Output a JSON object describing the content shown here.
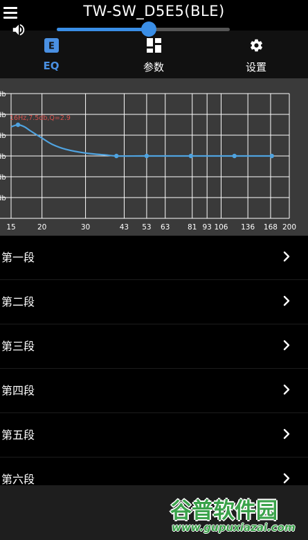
{
  "header": {
    "title": "TW-SW_D5E5(BLE)",
    "menu_icon": "hamburger-menu-icon"
  },
  "tabs": [
    {
      "label": "EQ",
      "icon": "eq-icon",
      "active": true
    },
    {
      "label": "参数",
      "icon": "grid-icon",
      "active": false
    },
    {
      "label": "设置",
      "icon": "gear-icon",
      "active": false
    }
  ],
  "colors": {
    "accent": "#4a90e2",
    "curve": "#4fa3e0",
    "chart_bg": "#3a3a3a",
    "grid": "#ffffff",
    "annotation": "#d9534f"
  },
  "chart_data": {
    "type": "line",
    "x_scale": "log",
    "x_ticks": [
      "15",
      "20",
      "30",
      "43",
      "53",
      "63",
      "81",
      "93",
      "106",
      "136",
      "168",
      "200"
    ],
    "y_tick_labels": [
      "db",
      "db",
      "db",
      "db",
      "db",
      "db"
    ],
    "annotation": "16Hz,7.5db,Q=2.9",
    "series": [
      {
        "x": [
          15,
          16,
          17,
          18,
          20,
          22,
          25,
          30,
          36,
          40,
          50,
          60,
          80,
          100,
          130,
          170
        ],
        "y": [
          7,
          7.5,
          7.0,
          6.0,
          4.3,
          2.8,
          1.6,
          0.7,
          0.25,
          0,
          0,
          0,
          0,
          0,
          0,
          0
        ]
      }
    ],
    "control_points": [
      16,
      40,
      53,
      80,
      120,
      170
    ]
  },
  "segments": [
    {
      "label": "第一段"
    },
    {
      "label": "第二段"
    },
    {
      "label": "第三段"
    },
    {
      "label": "第四段"
    },
    {
      "label": "第五段"
    },
    {
      "label": "第六段"
    }
  ],
  "volume": {
    "icon": "speaker-icon",
    "level": 0.54
  },
  "watermark": {
    "logo": "谷普软件园",
    "url": "www.gupuxiazai.com"
  }
}
